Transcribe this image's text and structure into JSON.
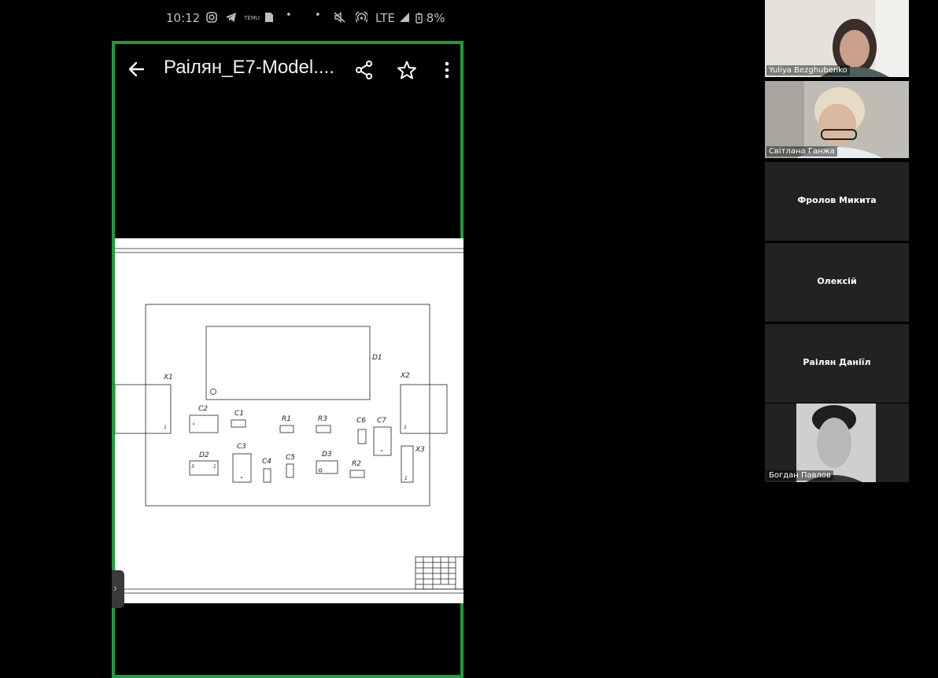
{
  "status_bar": {
    "time": "10:12",
    "network": "LTE",
    "battery": "8%",
    "icons": [
      "instagram-icon",
      "telegram-icon",
      "temu-icon",
      "sd-card-icon",
      "dot-icon",
      "dot-icon",
      "mute-icon",
      "hotspot-icon",
      "signal-icon",
      "battery-icon"
    ]
  },
  "viewer": {
    "title": "Раілян_Е7-Model....",
    "back_icon": "back-arrow-icon",
    "share_icon": "share-icon",
    "star_icon": "star-icon",
    "more_icon": "more-vert-icon",
    "frame_color": "#1f9d39"
  },
  "drawing": {
    "labels": {
      "d1": "D1",
      "x1": "X1",
      "x2": "X2",
      "x3": "X3",
      "c1": "C1",
      "c2": "C2",
      "c3": "C3",
      "c4": "C4",
      "c5": "C5",
      "c6": "C6",
      "c7": "C7",
      "r1": "R1",
      "r2": "R2",
      "r3": "R3",
      "d2": "D2",
      "d3": "D3",
      "pin1": "1",
      "pin3": "3"
    }
  },
  "participants": [
    {
      "name": "Yuliya Bezghubenko",
      "video": true
    },
    {
      "name": "Світлана Ганжа",
      "video": true
    },
    {
      "name": "Фролов Микита",
      "video": false
    },
    {
      "name": "Олексій",
      "video": false
    },
    {
      "name": "Раілян Даніїл",
      "video": false
    },
    {
      "name": "Богдан Павлов",
      "video": true
    }
  ]
}
